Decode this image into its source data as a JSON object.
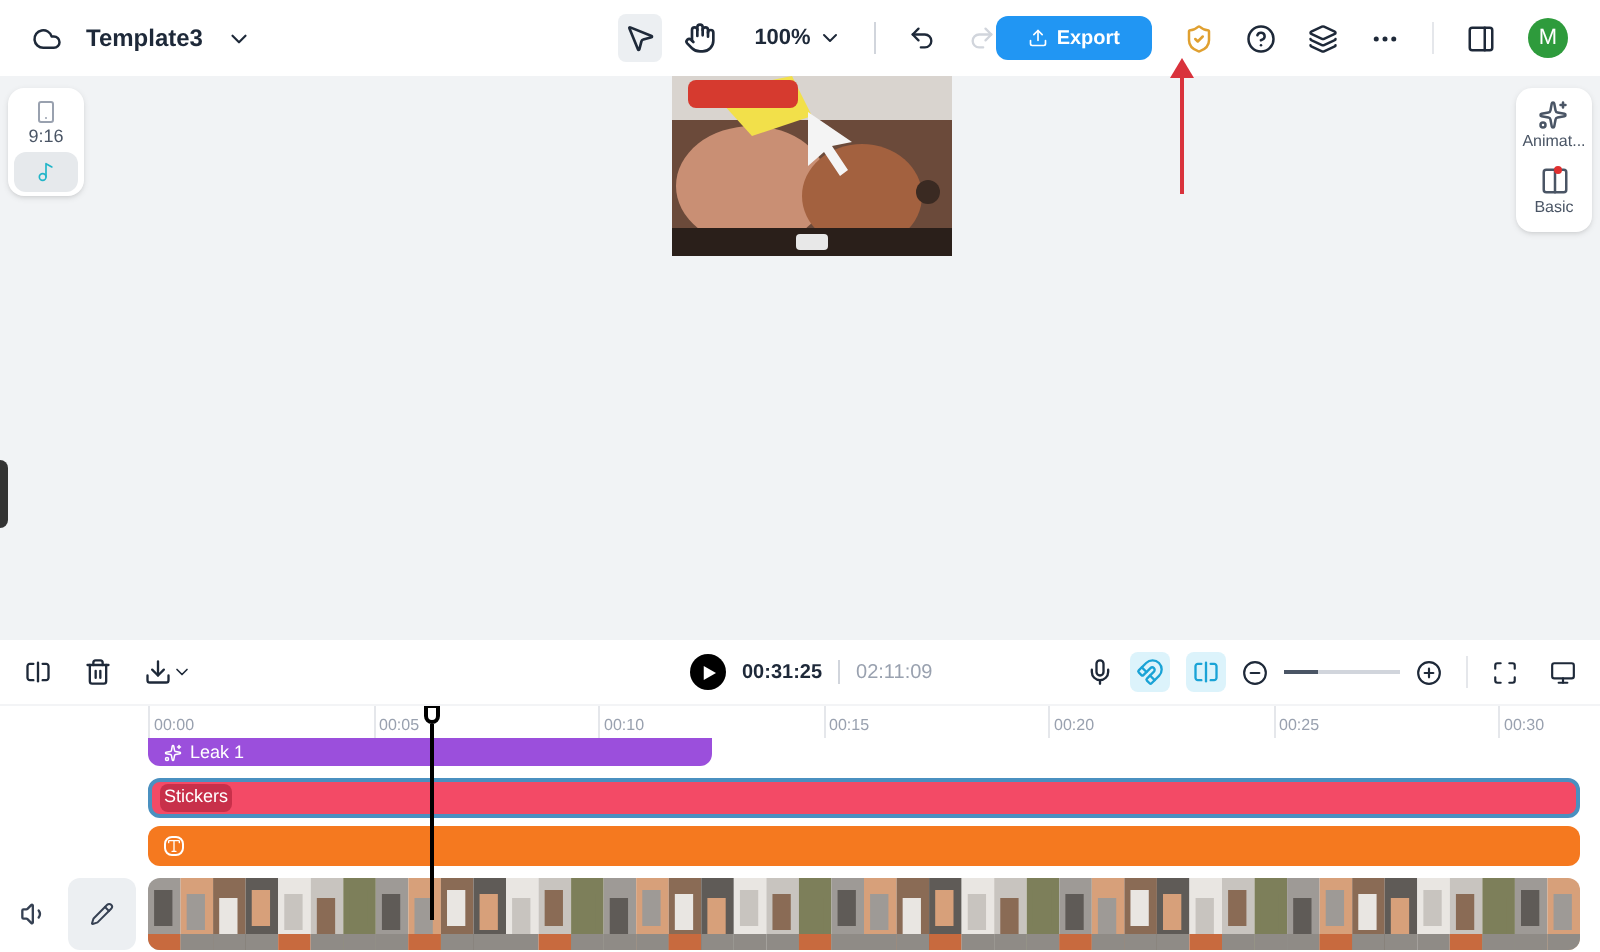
{
  "header": {
    "project_title": "Template3",
    "zoom": "100%",
    "tools": [
      {
        "kind": "select",
        "selected": true
      },
      {
        "kind": "hand",
        "selected": false
      }
    ],
    "export_label": "Export",
    "avatar": "M"
  },
  "left_panel": {
    "ratio": "9:16",
    "platform_selected": true
  },
  "right_panel": [
    {
      "kind": "animation",
      "label": "Animat...",
      "notify": false
    },
    {
      "kind": "basic",
      "label": "Basic",
      "notify": true
    }
  ],
  "timeline": {
    "current_time": "00:31:25",
    "total_time": "02:11:09",
    "toggles": [
      {
        "kind": "magnet",
        "on": true
      },
      {
        "kind": "split",
        "on": true
      }
    ],
    "zoom": {
      "level": 0.3
    },
    "ruler": [
      "00:00",
      "00:05",
      "00:10",
      "00:15",
      "00:20",
      "00:25",
      "00:30"
    ],
    "tracks": [
      {
        "kind": "effect",
        "label": "Leak 1"
      },
      {
        "kind": "sticker",
        "label": "Stickers",
        "selected": true
      },
      {
        "kind": "text"
      },
      {
        "kind": "video"
      }
    ]
  }
}
